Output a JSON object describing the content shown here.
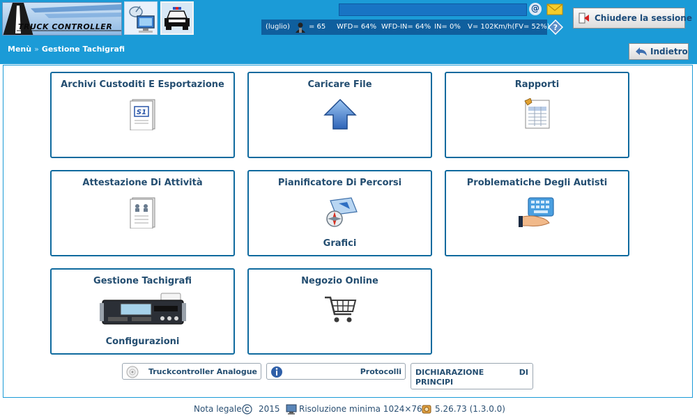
{
  "header": {
    "logo_text": "TRUCK CONTROLLER",
    "status": {
      "period": "(luglio)",
      "drivers_count": "= 65",
      "wfd": "WFD= 64%",
      "wfd_in": "WFD-IN= 64%",
      "in": "IN= 0%",
      "speed": "V= 102Km/h(FV= 52%)"
    },
    "logout_label": "Chiudere la sessione",
    "back_label": "Indietro",
    "icons": [
      "network-computer-icon",
      "police-car-icon",
      "email-at-icon",
      "mail-envelope-icon",
      "help-icon",
      "logout-door-icon",
      "back-arrow-icon"
    ]
  },
  "breadcrumb": {
    "root": "Menù",
    "separator": "»",
    "current": "Gestione Tachigrafi"
  },
  "tiles": [
    {
      "title": "Archivi Custoditi E Esportazione",
      "sub": "",
      "icon": "document-s1-icon"
    },
    {
      "title": "Caricare File",
      "sub": "",
      "icon": "upload-arrow-icon"
    },
    {
      "title": "Rapporti",
      "sub": "",
      "icon": "report-sheet-icon"
    },
    {
      "title": "Attestazione Di Attività",
      "sub": "",
      "icon": "attestation-document-icon"
    },
    {
      "title": "Pianificatore Di Percorsi",
      "sub": "Grafici",
      "icon": "route-planner-icon"
    },
    {
      "title": "Problematiche Degli Autisti",
      "sub": "",
      "icon": "hand-keyboard-icon"
    },
    {
      "title": "Gestione Tachigrafi",
      "sub": "Configurazioni",
      "icon": "tachograph-device-icon"
    },
    {
      "title": "Negozio Online",
      "sub": "",
      "icon": "shopping-cart-icon"
    }
  ],
  "bottom_buttons": {
    "analogue": "Truckcontroller Analogue",
    "protocols": "Protocolli",
    "declaration_line1": "DICHIARAZIONE DI",
    "declaration_line2": "PRINCIPI"
  },
  "footer": {
    "legal": "Nota legale",
    "year": "2015",
    "resolution": "Risoluzione minima 1024×768",
    "version": "5.26.73 (1.3.0.0)"
  }
}
